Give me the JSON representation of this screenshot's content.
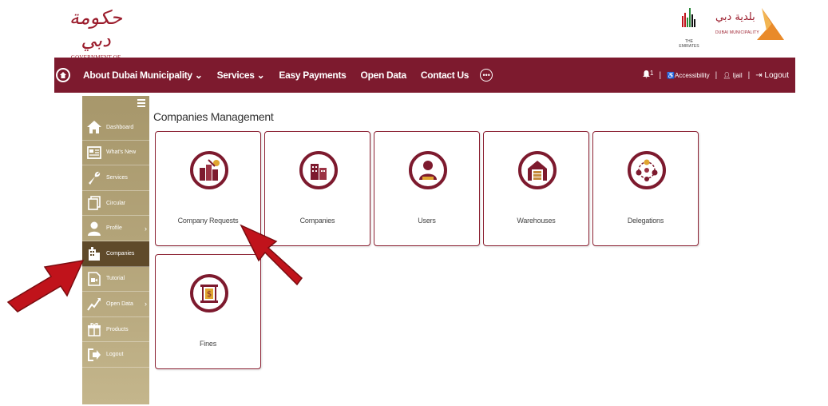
{
  "header": {
    "gov_logo_script": "حكومة دبي",
    "gov_logo_text": "GOVERNMENT OF DUBAI",
    "uae_logo_caption": "THE EMIRATES",
    "dm_logo_arabic": "بلدية دبي",
    "dm_logo_english": "DUBAI MUNICIPALITY"
  },
  "navbar": {
    "home_icon": "home-icon",
    "items": [
      "About Dubai Municipality ⌄",
      "Services ⌄",
      "Easy Payments",
      "Open Data",
      "Contact Us"
    ],
    "more_icon": "ellipsis-icon",
    "notifications_count": "1",
    "accessibility_label": "Accessibility",
    "user_label": "Ijail",
    "logout_label": "Logout"
  },
  "sidebar": {
    "items": [
      {
        "label": "Dashboard",
        "icon": "home-icon",
        "arrow": ""
      },
      {
        "label": "What's New",
        "icon": "newspaper-icon",
        "arrow": ""
      },
      {
        "label": "Services",
        "icon": "wrench-icon",
        "arrow": ""
      },
      {
        "label": "Circular",
        "icon": "documents-icon",
        "arrow": ""
      },
      {
        "label": "Profile",
        "icon": "user-icon",
        "arrow": "›"
      },
      {
        "label": "Companies",
        "icon": "building-icon",
        "arrow": ""
      },
      {
        "label": "Tutorial",
        "icon": "video-file-icon",
        "arrow": ""
      },
      {
        "label": "Open Data",
        "icon": "chart-line-icon",
        "arrow": "›"
      },
      {
        "label": "Products",
        "icon": "gift-icon",
        "arrow": ""
      },
      {
        "label": "Logout",
        "icon": "logout-icon",
        "arrow": ""
      }
    ],
    "active_index": 5
  },
  "main": {
    "title": "Companies Management",
    "tiles": [
      {
        "label": "Company Requests",
        "icon": "company-requests-icon"
      },
      {
        "label": "Companies",
        "icon": "companies-icon"
      },
      {
        "label": "Users",
        "icon": "users-icon"
      },
      {
        "label": "Warehouses",
        "icon": "warehouse-icon"
      },
      {
        "label": "Delegations",
        "icon": "delegations-icon"
      },
      {
        "label": "Fines",
        "icon": "fines-icon"
      }
    ]
  },
  "colors": {
    "brand_maroon": "#7d1a2e",
    "sidebar_gold": "#b0a074",
    "sidebar_active": "#5f4a2a",
    "annotation_arrow": "#c0131b"
  }
}
